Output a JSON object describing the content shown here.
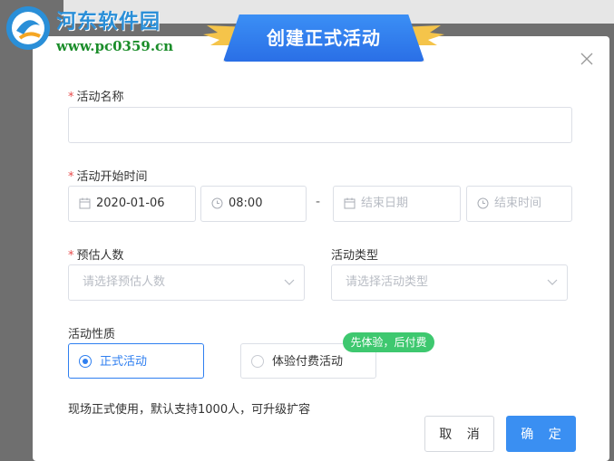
{
  "watermark": {
    "title": "河东软件园",
    "url": "www.pc0359.cn"
  },
  "dialog": {
    "title": "创建正式活动",
    "close_icon": "close-icon"
  },
  "form": {
    "name": {
      "label": "活动名称",
      "required_mark": "*",
      "value": ""
    },
    "start_time": {
      "label": "活动开始时间",
      "required_mark": "*",
      "start_date": "2020-01-06",
      "start_time": "08:00",
      "separator": "-",
      "end_date_placeholder": "结束日期",
      "end_time_placeholder": "结束时间"
    },
    "people": {
      "label": "预估人数",
      "required_mark": "*",
      "placeholder": "请选择预估人数"
    },
    "type": {
      "label": "活动类型",
      "placeholder": "请选择活动类型"
    },
    "nature": {
      "label": "活动性质",
      "options": [
        {
          "label": "正式活动",
          "selected": true
        },
        {
          "label": "体验付费活动",
          "selected": false
        }
      ],
      "badge": "先体验，后付费"
    },
    "hint": "现场正式使用，默认支持1000人，可升级扩容"
  },
  "buttons": {
    "cancel": "取 消",
    "confirm": "确 定"
  },
  "colors": {
    "primary": "#3a8ff2",
    "required": "#e84b4b",
    "badge": "#3ec86f"
  }
}
